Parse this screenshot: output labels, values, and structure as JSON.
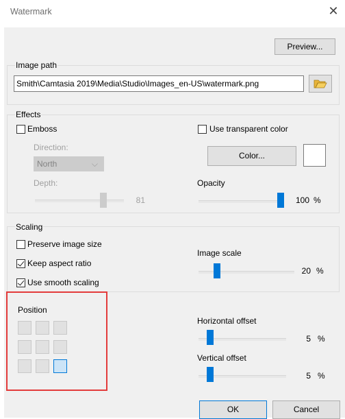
{
  "window": {
    "title": "Watermark",
    "close_glyph": "✕"
  },
  "buttons": {
    "preview": "Preview...",
    "color": "Color...",
    "ok": "OK",
    "cancel": "Cancel"
  },
  "image_path": {
    "label": "Image path",
    "value": "Smith\\Camtasia 2019\\Media\\Studio\\Images_en-US\\watermark.png",
    "browse_icon": "folder-open-icon"
  },
  "effects": {
    "label": "Effects",
    "emboss": {
      "label": "Emboss",
      "checked": false
    },
    "direction": {
      "label": "Direction:",
      "value": "North"
    },
    "depth": {
      "label": "Depth:",
      "value": "81"
    },
    "use_transparent": {
      "label": "Use transparent color",
      "checked": false
    },
    "opacity": {
      "label": "Opacity",
      "value": "100",
      "unit": "%"
    },
    "swatch_color": "#ffffff"
  },
  "scaling": {
    "label": "Scaling",
    "preserve": {
      "label": "Preserve image size",
      "checked": false
    },
    "keep_aspect": {
      "label": "Keep aspect ratio",
      "checked": true
    },
    "smooth": {
      "label": "Use smooth scaling",
      "checked": true
    },
    "image_scale": {
      "label": "Image scale",
      "value": "20",
      "unit": "%"
    }
  },
  "position": {
    "label": "Position",
    "selected_cell": 8,
    "horizontal": {
      "label": "Horizontal offset",
      "value": "5",
      "unit": "%"
    },
    "vertical": {
      "label": "Vertical offset",
      "value": "5",
      "unit": "%"
    }
  },
  "colors": {
    "accent": "#0078d7",
    "highlight": "#e33a3a",
    "panel": "#f0f0f0"
  }
}
